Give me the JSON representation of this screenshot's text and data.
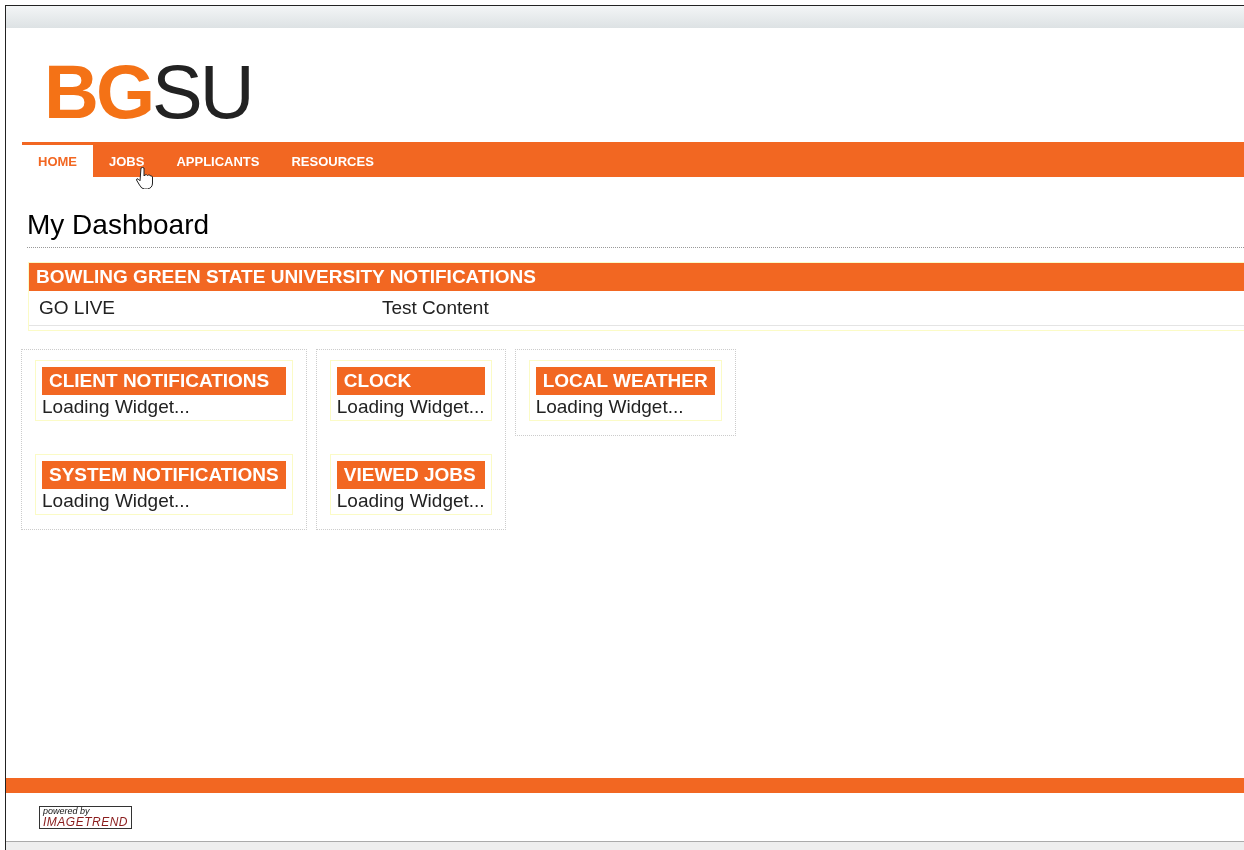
{
  "logo": {
    "accent": "BG",
    "rest": "SU"
  },
  "nav": [
    {
      "label": "HOME",
      "selected": true
    },
    {
      "label": "JOBS",
      "selected": false
    },
    {
      "label": "APPLICANTS",
      "selected": false
    },
    {
      "label": "RESOURCES",
      "selected": false
    }
  ],
  "page_title": "My Dashboard",
  "notifications": {
    "title": "BOWLING GREEN STATE UNIVERSITY NOTIFICATIONS",
    "rows": [
      {
        "subject": "GO LIVE",
        "content": "Test Content"
      }
    ]
  },
  "columns": [
    {
      "widgets": [
        {
          "title": "CLIENT NOTIFICATIONS",
          "body": "Loading Widget..."
        },
        {
          "title": "SYSTEM NOTIFICATIONS",
          "body": "Loading Widget..."
        }
      ]
    },
    {
      "widgets": [
        {
          "title": "CLOCK",
          "body": "Loading Widget..."
        },
        {
          "title": "VIEWED JOBS",
          "body": "Loading Widget..."
        }
      ]
    },
    {
      "widgets": [
        {
          "title": "LOCAL WEATHER",
          "body": "Loading Widget..."
        }
      ]
    }
  ],
  "footer": {
    "powered_by": "powered by",
    "brand": "IMAGETREND"
  }
}
